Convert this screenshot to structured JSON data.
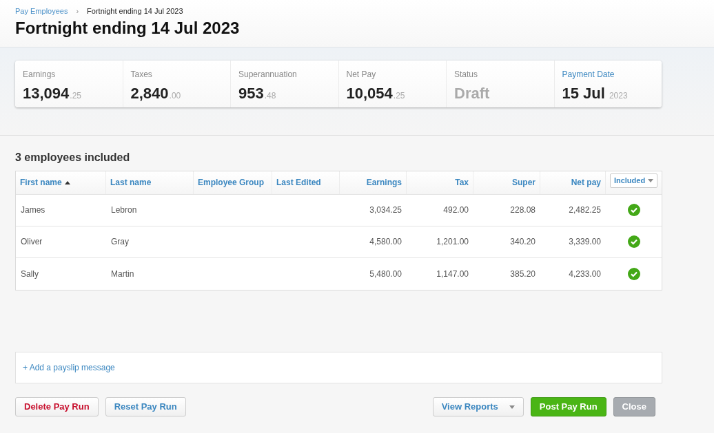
{
  "breadcrumb": {
    "parent": "Pay Employees",
    "separator": "›",
    "current": "Fortnight ending 14 Jul 2023"
  },
  "title": "Fortnight ending 14 Jul 2023",
  "summary": [
    {
      "kind": "amount",
      "label": "Earnings",
      "whole": "13,094",
      "fraction": ".25"
    },
    {
      "kind": "amount",
      "label": "Taxes",
      "whole": "2,840",
      "fraction": ".00"
    },
    {
      "kind": "amount",
      "label": "Superannuation",
      "whole": "953",
      "fraction": ".48"
    },
    {
      "kind": "amount",
      "label": "Net Pay",
      "whole": "10,054",
      "fraction": ".25"
    },
    {
      "kind": "status",
      "label": "Status",
      "whole": "Draft"
    },
    {
      "kind": "date",
      "label": "Payment Date",
      "whole": "15 Jul",
      "fraction": "2023"
    }
  ],
  "section_title": "3 employees included",
  "table": {
    "columns": [
      {
        "label": "First name",
        "kind": "text",
        "sorted": true
      },
      {
        "label": "Last name",
        "kind": "text",
        "sorted": false
      },
      {
        "label": "Employee Group",
        "kind": "text",
        "sorted": false
      },
      {
        "label": "Last Edited",
        "kind": "text",
        "sorted": false
      },
      {
        "label": "Earnings",
        "kind": "number",
        "sorted": false
      },
      {
        "label": "Tax",
        "kind": "number",
        "sorted": false
      },
      {
        "label": "Super",
        "kind": "number",
        "sorted": false
      },
      {
        "label": "Net pay",
        "kind": "number",
        "sorted": false
      }
    ],
    "filter": {
      "label": "Included"
    },
    "rows": [
      {
        "cells": [
          "James",
          "Lebron",
          "",
          "",
          "3,034.25",
          "492.00",
          "228.08",
          "2,482.25"
        ],
        "included": true
      },
      {
        "cells": [
          "Oliver",
          "Gray",
          "",
          "",
          "4,580.00",
          "1,201.00",
          "340.20",
          "3,339.00"
        ],
        "included": true
      },
      {
        "cells": [
          "Sally",
          "Martin",
          "",
          "",
          "5,480.00",
          "1,147.00",
          "385.20",
          "4,233.00"
        ],
        "included": true
      }
    ]
  },
  "payslip_message_link": "+ Add a payslip message",
  "buttons": [
    {
      "kind": "danger",
      "label": "Delete Pay Run"
    },
    {
      "kind": "default",
      "label": "Reset Pay Run"
    },
    {
      "kind": "dropdown",
      "label": "View Reports"
    },
    {
      "kind": "primary",
      "label": "Post Pay Run"
    },
    {
      "kind": "muted",
      "label": "Close"
    }
  ]
}
